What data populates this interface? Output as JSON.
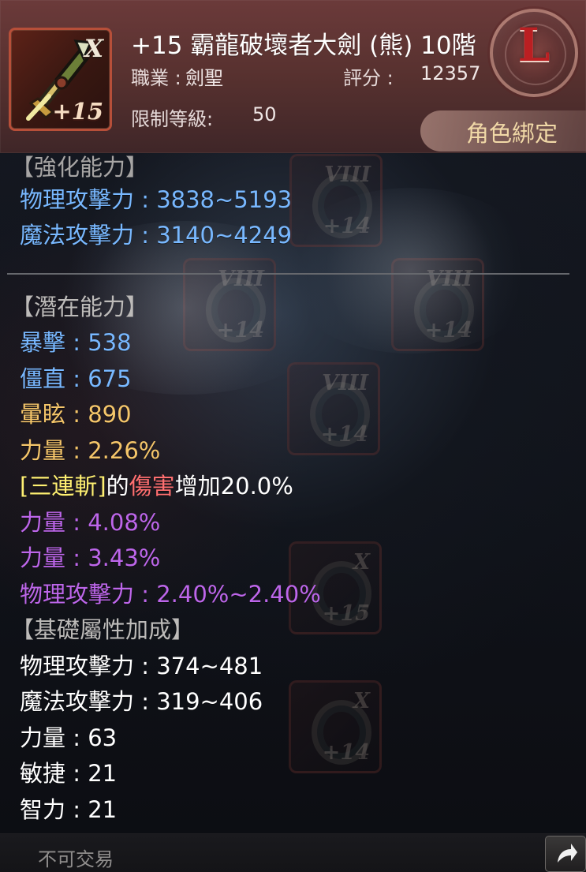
{
  "item": {
    "tier_mark": "X",
    "enhance_mark": "+15",
    "title": "+15 霸龍破壞者大劍 (熊) 10階",
    "job_label": "職業 :",
    "job_value": "劍聖",
    "score_label": "評分 :",
    "score_value": "12357",
    "level_label": "限制等級:",
    "level_value": "50",
    "grade_letter": "L",
    "binding": "角色綁定"
  },
  "enhanced_section": {
    "heading": "【強化能力】",
    "stats": [
      "物理攻擊力 : 3838~5193",
      "魔法攻擊力 : 3140~4249"
    ]
  },
  "potential_section": {
    "heading": "【潛在能力】",
    "stats": [
      "暴擊 : 538",
      "僵直 : 675",
      "暈眩 : 890",
      "力量 : 2.26%"
    ],
    "skill_bonus": {
      "bracket_skill": "[三連斬]",
      "middle_text": "的",
      "damage_word": "傷害",
      "suffix": "增加20.0%"
    },
    "extra_stats": [
      "力量 : 4.08%",
      "力量 : 3.43%",
      "物理攻擊力 : 2.40%~2.40%"
    ]
  },
  "base_section": {
    "heading": "【基礎屬性加成】",
    "stats": [
      "物理攻擊力 : 374~481",
      "魔法攻擊力 : 319~406",
      "力量 : 63",
      "敏捷 : 21",
      "智力 : 21"
    ]
  },
  "footer": {
    "trade_status": "不可交易"
  },
  "icons": {
    "item": "greatsword-icon",
    "grade": "l-grade-badge-icon",
    "share": "share-arrow-icon"
  },
  "colors": {
    "header_red": "#6b3a3a",
    "stat_blue": "#78b8ff",
    "stat_gold": "#f5c66a",
    "stat_purple": "#bd66ea",
    "binding_gold": "#f1d9a7"
  }
}
